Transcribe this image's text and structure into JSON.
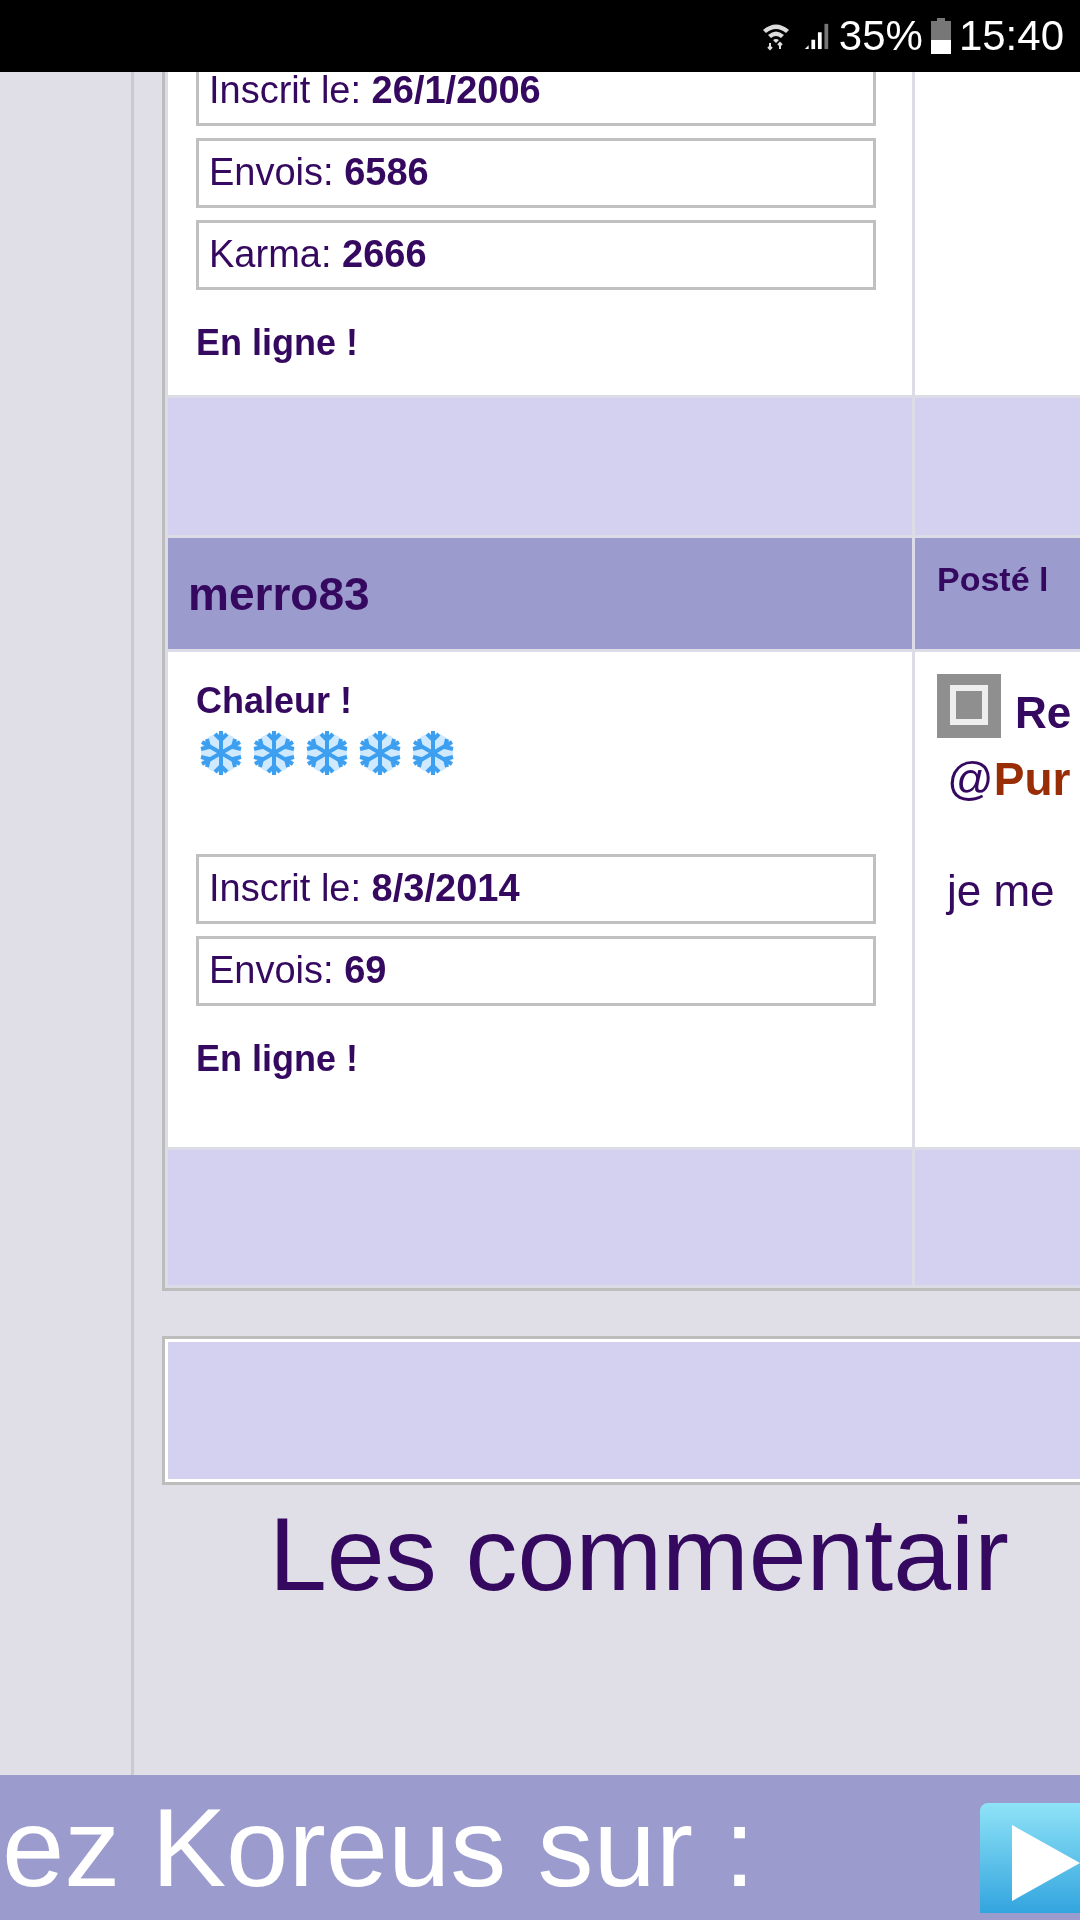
{
  "status_bar": {
    "battery": "35%",
    "time": "15:40"
  },
  "posts": [
    {
      "stats": [
        "Inscrit le: **26/1/2006**",
        "Envois: **6586**",
        "Karma: **2666**"
      ],
      "online": "En ligne !"
    },
    {
      "author": "merro83",
      "posted": "Posté l",
      "rank": "Chaleur !",
      "stars": 5,
      "stats": [
        "Inscrit le: **8/3/2014**",
        "Envois: **69**"
      ],
      "online": "En ligne !",
      "message": {
        "title": "Re",
        "mention_prefix": "@",
        "mention": "Pur",
        "body": "je me"
      }
    }
  ],
  "comments_heading": "Les commentair",
  "banner": {
    "text": "ez Koreus sur :"
  }
}
